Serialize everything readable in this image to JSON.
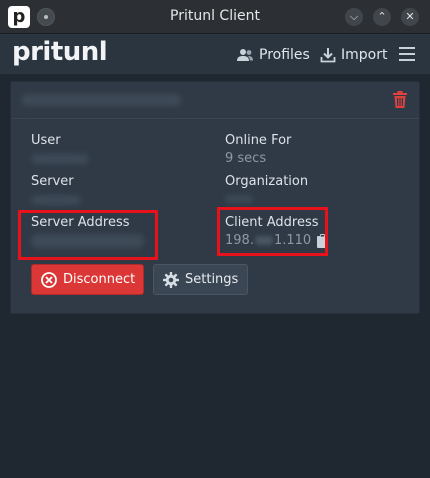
{
  "window": {
    "title": "Pritunl Client",
    "app_icon_letter": "p"
  },
  "header": {
    "logo": "pritunl",
    "profiles_label": "Profiles",
    "import_label": "Import"
  },
  "profile": {
    "name": "",
    "fields": {
      "user_label": "User",
      "user_value": "",
      "online_for_label": "Online For",
      "online_for_value": "9 secs",
      "server_label": "Server",
      "server_value": "",
      "organization_label": "Organization",
      "organization_value": "",
      "server_address_label": "Server Address",
      "server_address_value": "",
      "client_address_label": "Client Address",
      "client_address_prefix": "198.",
      "client_address_suffix": "1.110"
    },
    "buttons": {
      "disconnect_label": "Disconnect",
      "settings_label": "Settings"
    }
  },
  "colors": {
    "highlight": "#e8121c",
    "disconnect": "#db3737",
    "trash": "#e0413f"
  }
}
